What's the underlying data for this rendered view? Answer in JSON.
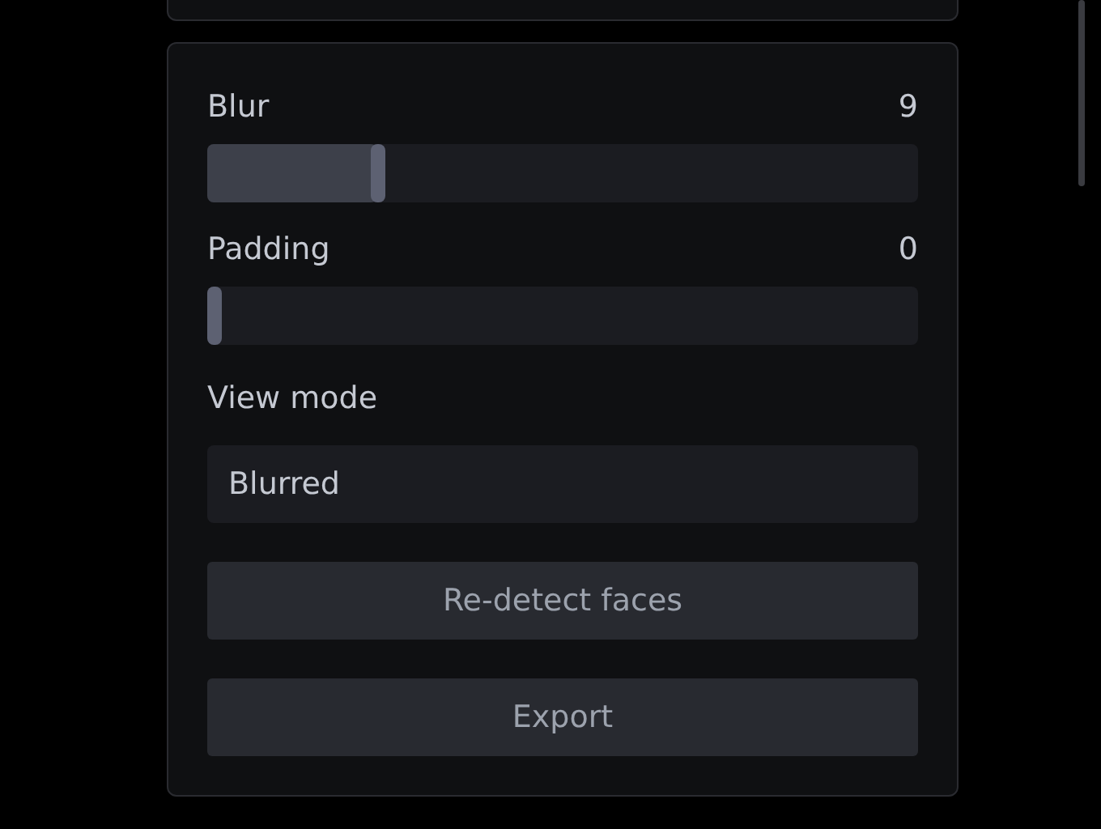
{
  "sliders": [
    {
      "label": "Blur",
      "reading": "9",
      "level": 0.23
    },
    {
      "label": "Padding",
      "reading": "0",
      "level": 0
    }
  ],
  "view_mode": {
    "label": "View mode",
    "value": "Blurred"
  },
  "buttons": [
    "Re-detect faces",
    "Export"
  ]
}
